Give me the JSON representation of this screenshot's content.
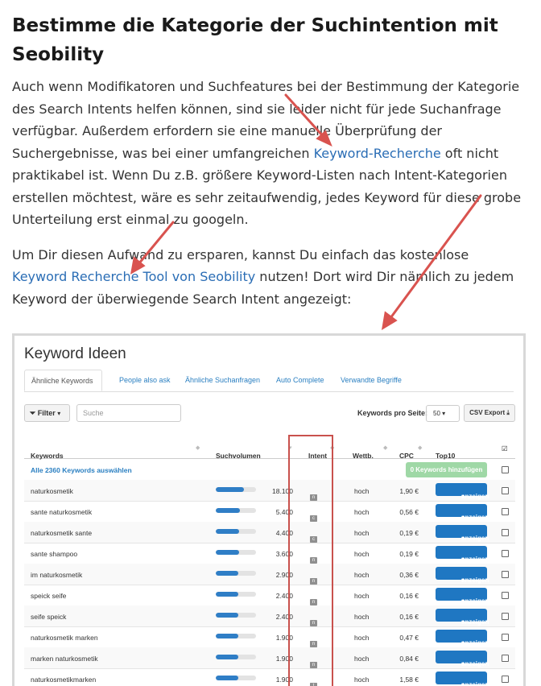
{
  "article": {
    "heading": "Bestimme die Kategorie der Suchintention mit Seobility",
    "p1": {
      "text_before": "Auch wenn Modifikatoren und Suchfeatures bei der Bestimmung der Kategorie des Search Intents helfen können, sind sie leider nicht für jede Suchanfrage verfügbar. Außerdem erfordern sie eine manuelle Überprüfung der Suchergebnisse, was bei einer umfangreichen ",
      "link": "Keyword-Recherche",
      "text_after": " oft nicht praktikabel ist. Wenn Du z.B. größere Keyword-Listen nach Intent-Kategorien erstellen möchtest, wäre es sehr zeitaufwendig, jedes Keyword für diese grobe Unterteilung erst einmal zu googeln."
    },
    "p2": {
      "text_before": "Um Dir diesen Aufwand zu ersparen, kannst Du einfach das kostenlose ",
      "link": "Keyword Recherche Tool von Seobility",
      "text_after": " nutzen! Dort wird Dir nämlich zu jedem Keyword der überwiegende Search Intent angezeigt:"
    }
  },
  "tool": {
    "title": "Keyword Ideen",
    "tabs": [
      "Ähnliche Keywords",
      "People also ask",
      "Ähnliche Suchanfragen",
      "Auto Complete",
      "Verwandte Begriffe"
    ],
    "active_tab": "Ähnliche Keywords",
    "filter_label": "Filter",
    "search_placeholder": "Suche",
    "keywords_per_page_label": "Keywords pro Seite:",
    "keywords_per_page_value": "50",
    "csv_label": "CSV Export",
    "columns": {
      "keywords": "Keywords",
      "volume": "Suchvolumen",
      "intent": "Intent",
      "competition": "Wettb.",
      "cpc": "CPC",
      "top10": "Top10"
    },
    "select_all": "Alle 2360 Keywords auswählen",
    "add_button": "0 Keywords hinzufügen",
    "show_button": "anzeigen",
    "rows": [
      {
        "keyword": "naturkosmetik",
        "volume": "18.100",
        "volume_fraction": 0.7,
        "intent": [
          "c",
          "n"
        ],
        "competition": "hoch",
        "cpc": "1,90 €"
      },
      {
        "keyword": "sante naturkosmetik",
        "volume": "5.400",
        "volume_fraction": 0.6,
        "intent": [
          "n",
          "c"
        ],
        "competition": "hoch",
        "cpc": "0,56 €"
      },
      {
        "keyword": "naturkosmetik sante",
        "volume": "4.400",
        "volume_fraction": 0.58,
        "intent": [
          "n",
          "c"
        ],
        "competition": "hoch",
        "cpc": "0,19 €"
      },
      {
        "keyword": "sante shampoo",
        "volume": "3.600",
        "volume_fraction": 0.58,
        "intent": [
          "n"
        ],
        "competition": "hoch",
        "cpc": "0,19 €"
      },
      {
        "keyword": "im naturkosmetik",
        "volume": "2.900",
        "volume_fraction": 0.56,
        "intent": [
          "c",
          "n"
        ],
        "competition": "hoch",
        "cpc": "0,36 €"
      },
      {
        "keyword": "speick seife",
        "volume": "2.400",
        "volume_fraction": 0.56,
        "intent": [
          "n"
        ],
        "competition": "hoch",
        "cpc": "0,16 €"
      },
      {
        "keyword": "seife speick",
        "volume": "2.400",
        "volume_fraction": 0.56,
        "intent": [
          "n"
        ],
        "competition": "hoch",
        "cpc": "0,16 €"
      },
      {
        "keyword": "naturkosmetik marken",
        "volume": "1.900",
        "volume_fraction": 0.56,
        "intent": [
          "c",
          "n"
        ],
        "competition": "hoch",
        "cpc": "0,47 €"
      },
      {
        "keyword": "marken naturkosmetik",
        "volume": "1.900",
        "volume_fraction": 0.56,
        "intent": [
          "c",
          "n"
        ],
        "competition": "hoch",
        "cpc": "0,84 €"
      },
      {
        "keyword": "naturkosmetikmarken",
        "volume": "1.900",
        "volume_fraction": 0.56,
        "intent": [
          "c",
          "t"
        ],
        "competition": "hoch",
        "cpc": "1,58 €"
      }
    ]
  },
  "colors": {
    "link": "#2a6db5",
    "arrow": "#d9534f",
    "intent_highlight": "#c9514d",
    "button_blue": "#1f77c2",
    "add_button_green": "#9fd8a6",
    "volume_bar": "#2f7ec6"
  }
}
